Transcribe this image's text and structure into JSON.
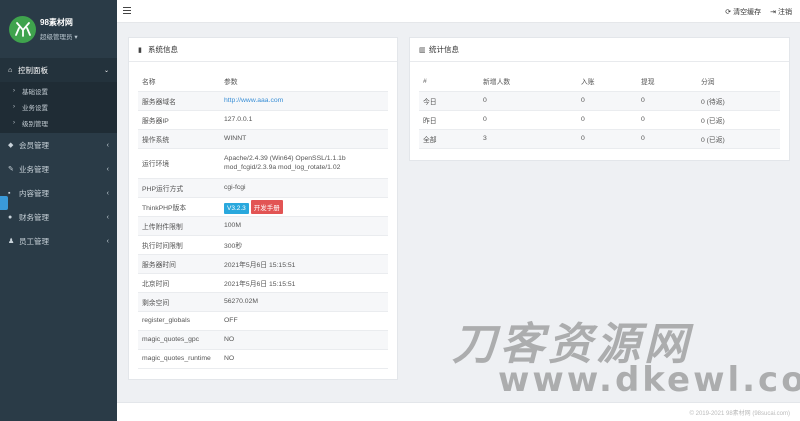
{
  "brand": {
    "title": "98素材网",
    "user": "超级管理员"
  },
  "sidebar": {
    "active_head": {
      "label": "控制面板",
      "icon": "home-icon"
    },
    "submenu": [
      {
        "label": "基础设置"
      },
      {
        "label": "业务设置"
      },
      {
        "label": "级别管理"
      }
    ],
    "items": [
      {
        "label": "会员管理",
        "icon": "tag-icon"
      },
      {
        "label": "业务管理",
        "icon": "edit-icon"
      },
      {
        "label": "内容管理",
        "icon": "folder-icon"
      },
      {
        "label": "财务管理",
        "icon": "money-icon"
      },
      {
        "label": "员工管理",
        "icon": "user-icon"
      }
    ]
  },
  "topbar": {
    "clear_cache": "清空缓存",
    "logout": "注销"
  },
  "system_panel": {
    "title": "系统信息",
    "headers": {
      "name": "名称",
      "param": "参数"
    },
    "rows": [
      {
        "k": "服务器域名",
        "v": "http://www.aaa.com"
      },
      {
        "k": "服务器IP",
        "v": "127.0.0.1"
      },
      {
        "k": "操作系统",
        "v": "WINNT"
      },
      {
        "k": "运行环境",
        "v": "Apache/2.4.39 (Win64) OpenSSL/1.1.1b mod_fcgid/2.3.9a mod_log_rotate/1.02"
      },
      {
        "k": "PHP运行方式",
        "v": "cgi-fcgi"
      },
      {
        "k": "ThinkPHP版本",
        "v": "V3.2.3",
        "v2": "开发手册"
      },
      {
        "k": "上传附件限制",
        "v": "100M"
      },
      {
        "k": "执行时间限制",
        "v": "300秒"
      },
      {
        "k": "服务器时间",
        "v": "2021年5月6日 15:15:51"
      },
      {
        "k": "北京时间",
        "v": "2021年5月6日 15:15:51"
      },
      {
        "k": "剩余空间",
        "v": "56270.02M"
      },
      {
        "k": "register_globals",
        "v": "OFF"
      },
      {
        "k": "magic_quotes_gpc",
        "v": "NO"
      },
      {
        "k": "magic_quotes_runtime",
        "v": "NO"
      }
    ]
  },
  "stats_panel": {
    "title": "统计信息",
    "headers": [
      "#",
      "新增人数",
      "入账",
      "提现",
      "分润"
    ],
    "rows": [
      [
        "今日",
        "0",
        "0",
        "0",
        "0 (待返)"
      ],
      [
        "昨日",
        "0",
        "0",
        "0",
        "0 (已返)"
      ],
      [
        "全部",
        "3",
        "0",
        "0",
        "0 (已返)"
      ]
    ]
  },
  "footer": {
    "text": "© 2019-2021 98素材网 (98sucai.com)"
  },
  "watermark": {
    "cn": "刀客资源网",
    "en": "www.dkewl.com"
  }
}
